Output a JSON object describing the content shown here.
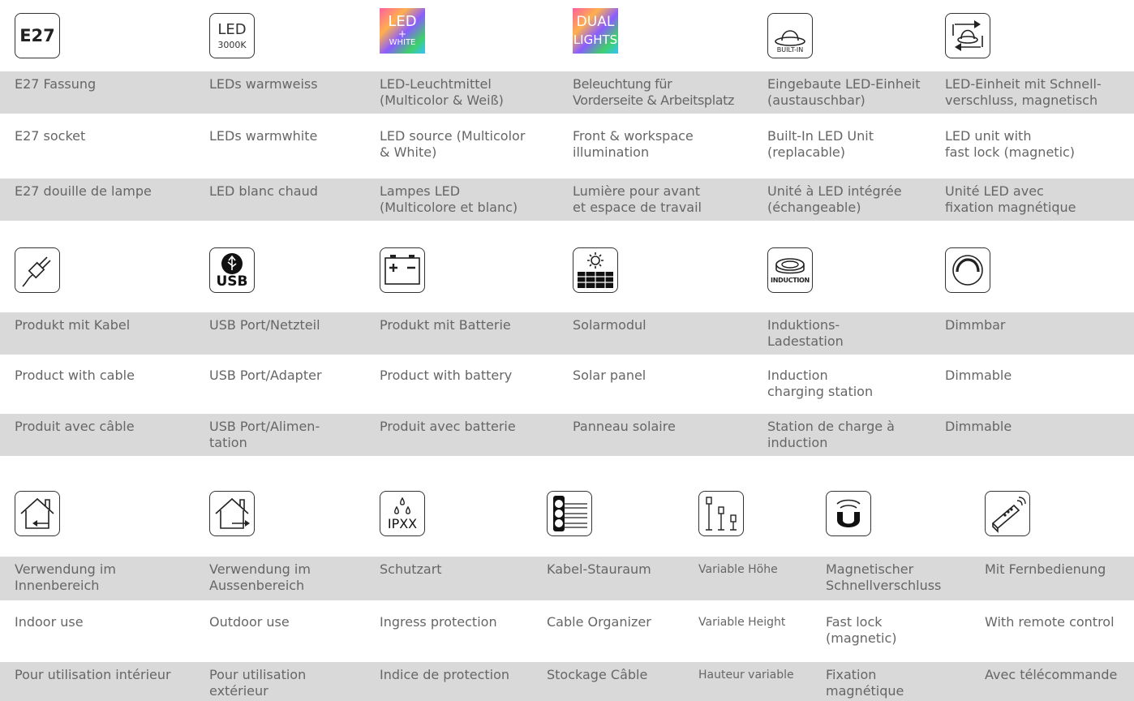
{
  "section1": {
    "icons": [
      {
        "name": "e27-icon",
        "label": "E27"
      },
      {
        "name": "led-3000k-icon",
        "label": "LED",
        "sub": "3000K"
      },
      {
        "name": "led-white-icon",
        "label": "LED",
        "plus": "+",
        "sub": "WHITE"
      },
      {
        "name": "dual-lights-icon",
        "label": "DUAL",
        "sub": "LIGHTS"
      },
      {
        "name": "built-in-icon",
        "label": "BUILT-IN"
      },
      {
        "name": "fast-lock-icon"
      }
    ],
    "rows": [
      [
        "E27 Fassung",
        "LEDs warmweiss",
        "LED-Leuchtmittel\n(Multicolor & Weiß)",
        "Beleuchtung für\nVorderseite & Arbeitsplatz",
        "Eingebaute LED-Einheit\n(austauschbar)",
        "LED-Einheit mit Schnell-\nverschluss, magnetisch"
      ],
      [
        "E27 socket",
        "LEDs warmwhite",
        "LED source (Multicolor\n& White)",
        "Front & workspace\nillumination",
        "Built-In LED Unit\n(replacable)",
        "LED unit with\nfast lock (magnetic)"
      ],
      [
        "E27 douille de lampe",
        "LED blanc chaud",
        "Lampes LED\n(Multicolore et blanc)",
        "Lumière pour avant\net espace de travail",
        "Unité à LED intégrée\n(échangeable)",
        "Unité LED avec\nfixation magnétique"
      ]
    ]
  },
  "section2": {
    "icons": [
      {
        "name": "plug-icon"
      },
      {
        "name": "usb-icon",
        "label": "USB"
      },
      {
        "name": "battery-icon"
      },
      {
        "name": "solar-panel-icon"
      },
      {
        "name": "induction-icon",
        "label": "INDUCTION"
      },
      {
        "name": "dimmer-icon"
      }
    ],
    "rows": [
      [
        "Produkt mit Kabel",
        "USB Port/Netzteil",
        "Produkt mit Batterie",
        "Solarmodul",
        "Induktions-\nLadestation",
        "Dimmbar"
      ],
      [
        "Product with cable",
        "USB Port/Adapter",
        "Product with battery",
        "Solar panel",
        "Induction\ncharging station",
        "Dimmable"
      ],
      [
        "Produit avec câble",
        "USB Port/Alimen-\ntation",
        "Produit avec batterie",
        "Panneau solaire",
        "Station de charge à\ninduction",
        "Dimmable"
      ]
    ]
  },
  "section3": {
    "icons": [
      {
        "name": "indoor-use-icon"
      },
      {
        "name": "outdoor-use-icon"
      },
      {
        "name": "ingress-protection-icon",
        "label": "IPXX"
      },
      {
        "name": "cable-organizer-icon"
      },
      {
        "name": "variable-height-icon"
      },
      {
        "name": "magnet-icon"
      },
      {
        "name": "remote-control-icon"
      }
    ],
    "rows": [
      [
        "Verwendung im\nInnenbereich",
        "Verwendung im\nAussenbereich",
        "Schutzart",
        "Kabel-Stauraum",
        "Variable Höhe",
        "Magnetischer\nSchnellverschluss",
        "Mit Fernbedienung"
      ],
      [
        "Indoor use",
        "Outdoor use",
        "Ingress protection",
        "Cable Organizer",
        "Variable Height",
        "Fast lock\n(magnetic)",
        "With remote control"
      ],
      [
        "Pour utilisation intérieur",
        "Pour utilisation\nextérieur",
        "Indice de protection",
        "Stockage Câble",
        "Hauteur variable",
        "Fixation\nmagnétique",
        "Avec télécommande"
      ]
    ]
  }
}
